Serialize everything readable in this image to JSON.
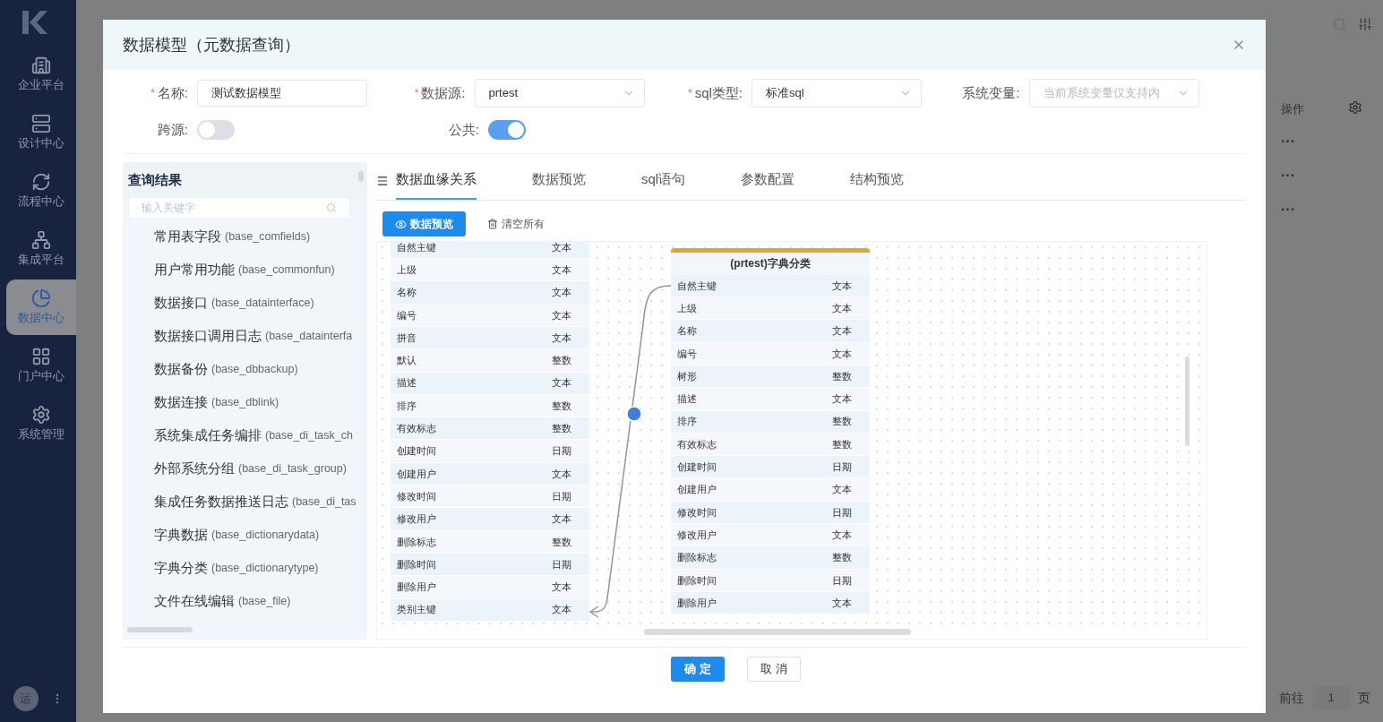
{
  "sidebar": {
    "items": [
      {
        "label": "企业平台",
        "selected": false
      },
      {
        "label": "设计中心",
        "selected": false
      },
      {
        "label": "流程中心",
        "selected": false
      },
      {
        "label": "集成平台",
        "selected": false
      },
      {
        "label": "数据中心",
        "selected": true
      },
      {
        "label": "门户中心",
        "selected": false
      },
      {
        "label": "系统管理",
        "selected": false
      }
    ],
    "avatar": "运"
  },
  "background": {
    "column_header": "操作",
    "row_actions": [
      "···",
      "···",
      "···"
    ],
    "pagination": {
      "goto_label": "前往",
      "page": "1",
      "unit": "页"
    }
  },
  "dialog": {
    "title": "数据模型（元数据查询）",
    "fields": [
      {
        "label": "名称:",
        "mark": "*",
        "kind": "input",
        "value": "测试数据模型"
      },
      {
        "label": "数据源:",
        "mark": "*",
        "kind": "select",
        "value": "prtest"
      },
      {
        "label": "sql类型:",
        "mark": "*",
        "kind": "select",
        "value": "标准sql"
      },
      {
        "label": "系统变量:",
        "kind": "select",
        "placeholder": "当前系统变量仅支持内"
      }
    ],
    "switches": [
      {
        "label": "跨源:",
        "on": false
      },
      {
        "label": "公共:",
        "on": true
      }
    ],
    "query_panel": {
      "title": "查询结果",
      "search": {
        "placeholder": "输入关键字"
      },
      "items": [
        {
          "name": "常用表字段",
          "table": "(base_comfields)"
        },
        {
          "name": "用户常用功能",
          "table": "(base_commonfun)"
        },
        {
          "name": "数据接口",
          "table": "(base_datainterface)"
        },
        {
          "name": "数据接口调用日志",
          "table": "(base_datainterfa"
        },
        {
          "name": "数据备份",
          "table": "(base_dbbackup)"
        },
        {
          "name": "数据连接",
          "table": "(base_dblink)"
        },
        {
          "name": "系统集成任务编排",
          "table": "(base_di_task_ch"
        },
        {
          "name": "外部系统分组",
          "table": "(base_di_task_group)"
        },
        {
          "name": "集成任务数据推送日志",
          "table": "(base_di_tas"
        },
        {
          "name": "字典数据",
          "table": "(base_dictionarydata)"
        },
        {
          "name": "字典分类",
          "table": "(base_dictionarytype)"
        },
        {
          "name": "文件在线编辑",
          "table": "(base_file)"
        }
      ]
    },
    "tabs": [
      {
        "label": "数据血缘关系",
        "selected": true
      },
      {
        "label": "数据预览",
        "selected": false
      },
      {
        "label": "sql语句",
        "selected": false
      },
      {
        "label": "参数配置",
        "selected": false
      },
      {
        "label": "结构预览",
        "selected": false
      }
    ],
    "toolbar": [
      {
        "label": "数据预览",
        "kind": "primary"
      },
      {
        "label": "清空所有",
        "kind": "clear"
      }
    ],
    "tables": [
      {
        "rows": [
          {
            "field": "自然主键",
            "type": "文本"
          },
          {
            "field": "上级",
            "type": "文本"
          },
          {
            "field": "名称",
            "type": "文本"
          },
          {
            "field": "编号",
            "type": "文本"
          },
          {
            "field": "拼音",
            "type": "文本"
          },
          {
            "field": "默认",
            "type": "整数"
          },
          {
            "field": "描述",
            "type": "文本"
          },
          {
            "field": "排序",
            "type": "整数"
          },
          {
            "field": "有效标志",
            "type": "整数"
          },
          {
            "field": "创建时间",
            "type": "日期"
          },
          {
            "field": "创建用户",
            "type": "文本"
          },
          {
            "field": "修改时间",
            "type": "日期"
          },
          {
            "field": "修改用户",
            "type": "文本"
          },
          {
            "field": "删除标志",
            "type": "整数"
          },
          {
            "field": "删除时间",
            "type": "日期"
          },
          {
            "field": "删除用户",
            "type": "文本"
          },
          {
            "field": "类别主键",
            "type": "文本"
          }
        ]
      },
      {
        "title": "(prtest)字典分类",
        "rows": [
          {
            "field": "自然主键",
            "type": "文本"
          },
          {
            "field": "上级",
            "type": "文本"
          },
          {
            "field": "名称",
            "type": "文本"
          },
          {
            "field": "编号",
            "type": "文本"
          },
          {
            "field": "树形",
            "type": "整数"
          },
          {
            "field": "描述",
            "type": "文本"
          },
          {
            "field": "排序",
            "type": "整数"
          },
          {
            "field": "有效标志",
            "type": "整数"
          },
          {
            "field": "创建时间",
            "type": "日期"
          },
          {
            "field": "创建用户",
            "type": "文本"
          },
          {
            "field": "修改时间",
            "type": "日期"
          },
          {
            "field": "修改用户",
            "type": "文本"
          },
          {
            "field": "删除标志",
            "type": "整数"
          },
          {
            "field": "删除时间",
            "type": "日期"
          },
          {
            "field": "删除用户",
            "type": "文本"
          }
        ]
      }
    ],
    "buttons": [
      {
        "label": "确 定",
        "kind": "primary"
      },
      {
        "label": "取 消",
        "kind": "default"
      }
    ]
  }
}
